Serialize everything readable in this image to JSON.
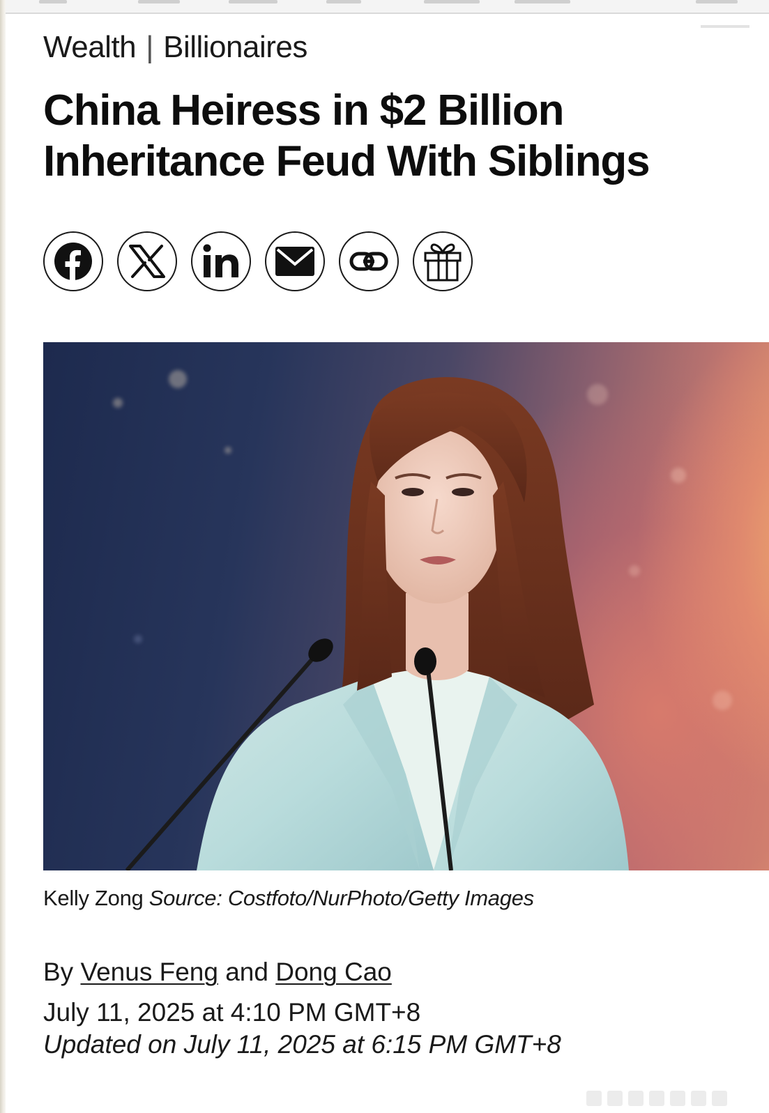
{
  "article": {
    "breadcrumb": {
      "section": "Wealth",
      "subsection": "Billionaires"
    },
    "headline_line1": "China Heiress in $2 Billion",
    "headline_line2": "Inheritance Feud With Siblings",
    "share_buttons": [
      {
        "icon": "facebook-icon"
      },
      {
        "icon": "x-icon"
      },
      {
        "icon": "linkedin-icon"
      },
      {
        "icon": "email-icon"
      },
      {
        "icon": "link-icon"
      },
      {
        "icon": "gift-icon"
      }
    ],
    "caption": {
      "subject": "Kelly Zong",
      "source": "Source: Costfoto/NurPhoto/Getty Images"
    },
    "byline": {
      "prefix": "By",
      "author1": "Venus Feng",
      "conjunction": "and",
      "author2": "Dong Cao"
    },
    "published": "July 11, 2025 at 4:10 PM GMT+8",
    "updated": "Updated on July 11, 2025 at 6:15 PM GMT+8"
  }
}
